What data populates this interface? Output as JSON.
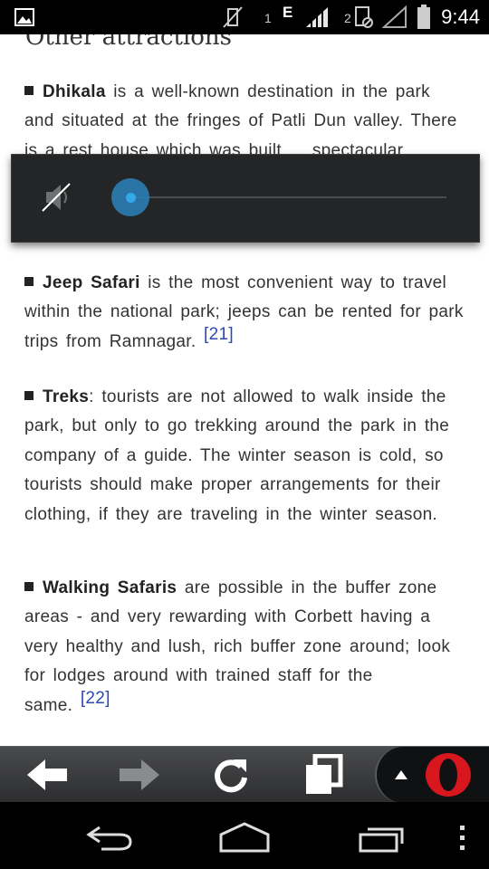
{
  "status_bar": {
    "time": "9:44",
    "sim1_label": "1",
    "network_type": "E",
    "sim2_label": "2",
    "icons": [
      "image-notification-icon",
      "vibrate-off-icon",
      "signal-icon",
      "sim2-icon",
      "no-signal-icon",
      "battery-icon"
    ]
  },
  "article": {
    "heading": "Other attractions",
    "items": [
      {
        "term": "Dhikala",
        "text": " is a well-known  destination  in the park and situated at the fringes of Patli Dun valley. There is a rest house which was built ... spectacular natural beauty of the valley."
      },
      {
        "term": "Jeep Safari",
        "text": " is the  most convenient  way to travel  within  the  national  park;  jeeps  can  be rented  for  park trips  from  Ramnagar.",
        "ref": "[21]"
      },
      {
        "term": "Treks",
        "text": ": tourists  are  not allowed  to walk inside the park, but only to go trekking  around the park in the company of a guide. The winter season is cold, so tourists should make proper arrangements  for their  clothing, if  they are traveling  in the winter  season."
      },
      {
        "term": "Walking Safaris",
        "text": " are possible  in the buffer zone areas  - and very rewarding  with Corbett having a very healthy and lush, rich buffer zone around; look for lodges around with trained staff for the same.",
        "ref": "[22]"
      }
    ]
  },
  "volume_overlay": {
    "icon": "speaker-muted-icon",
    "level": 0
  },
  "browser_toolbar": {
    "buttons": [
      "back-arrow-icon",
      "forward-arrow-icon",
      "reload-icon",
      "tabs-icon",
      "opera-menu-icon"
    ]
  },
  "nav_bar": {
    "buttons": [
      "back-icon",
      "home-icon",
      "recent-apps-icon",
      "overflow-menu-icon"
    ]
  },
  "colors": {
    "link": "#2a49b3",
    "volume_accent": "#38b6ff",
    "opera_red": "#d7161e"
  }
}
